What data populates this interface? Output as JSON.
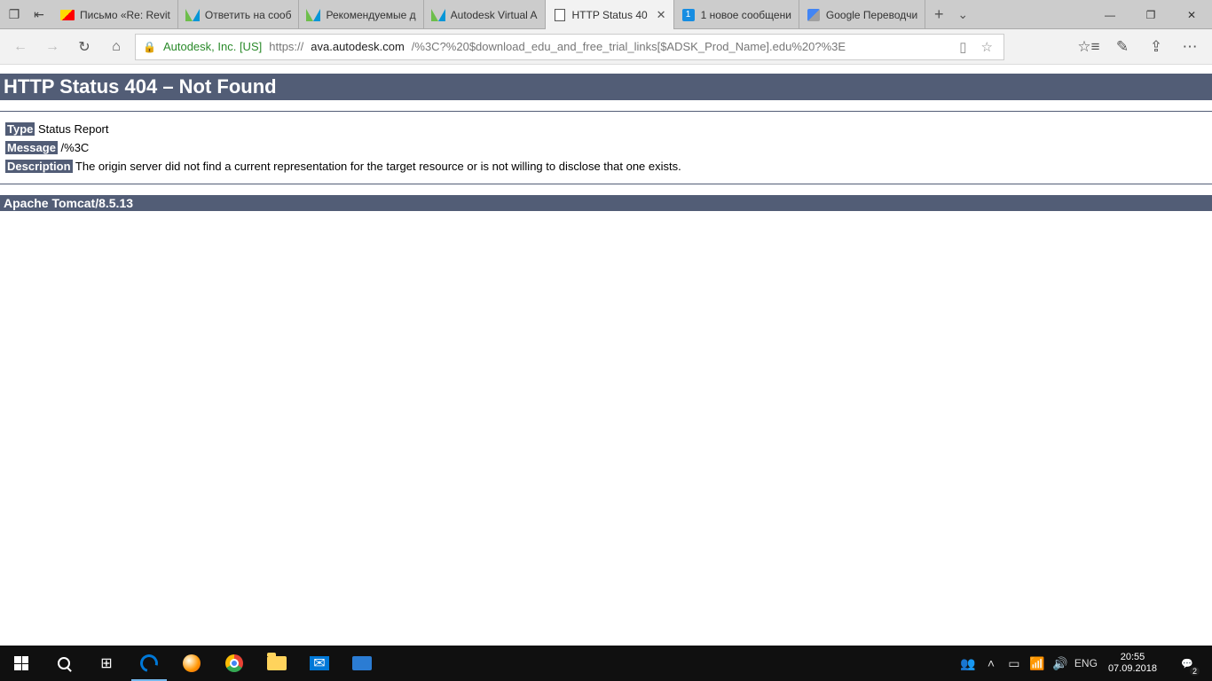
{
  "tabs": [
    {
      "label": "Письмо «Re: Revit",
      "icon": "yandex"
    },
    {
      "label": "Ответить на сооб",
      "icon": "autodesk"
    },
    {
      "label": "Рекомендуемые д",
      "icon": "autodesk"
    },
    {
      "label": "Autodesk Virtual A",
      "icon": "autodesk"
    },
    {
      "label": "HTTP Status 40",
      "icon": "page",
      "active": true
    },
    {
      "label": "1 новое сообщени",
      "icon": "mailru",
      "badge": "1"
    },
    {
      "label": "Google Переводчи",
      "icon": "gtrans"
    }
  ],
  "address": {
    "owner": "Autodesk, Inc. [US]",
    "url_prefix": "https://",
    "url_host": "ava.autodesk.com",
    "url_path": "/%3C?%20$download_edu_and_free_trial_links[$ADSK_Prod_Name].edu%20?%3E"
  },
  "page": {
    "heading": "HTTP Status 404 – Not Found",
    "type_label": "Type",
    "type_value": " Status Report",
    "message_label": "Message",
    "message_value": " /%3C",
    "description_label": "Description",
    "description_value": " The origin server did not find a current representation for the target resource or is not willing to disclose that one exists.",
    "server": "Apache Tomcat/8.5.13"
  },
  "tray": {
    "lang": "ENG",
    "time": "20:55",
    "date": "07.09.2018",
    "notif_count": "2"
  }
}
